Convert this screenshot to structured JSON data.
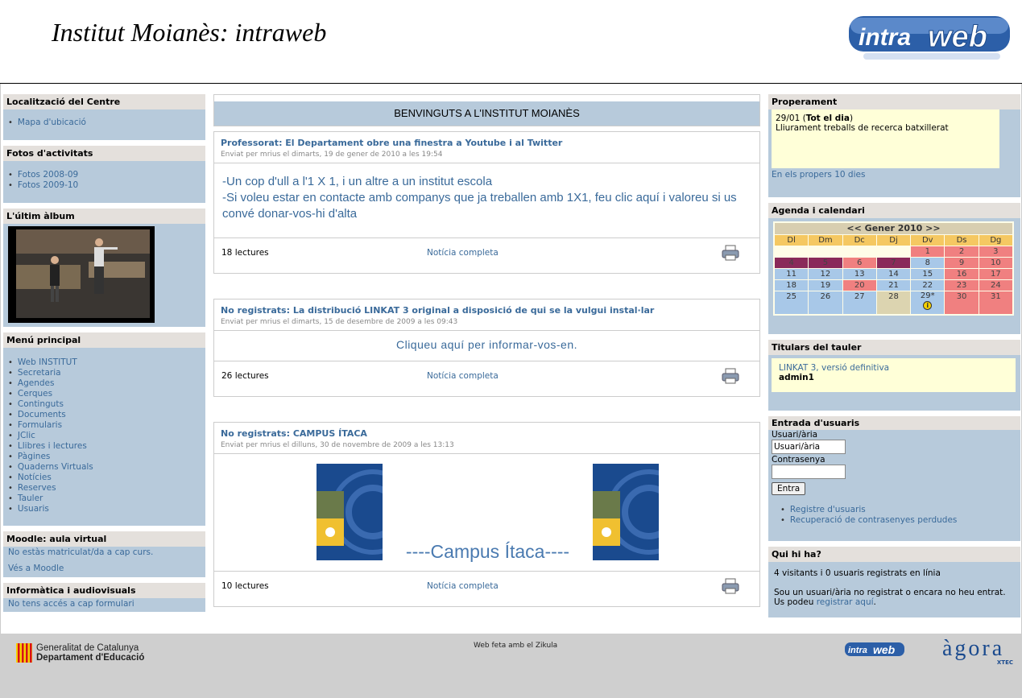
{
  "header": {
    "title": "Institut Moianès: intraweb",
    "logo": "intraweb"
  },
  "left": {
    "localitzacio": {
      "title": "Localització del Centre",
      "items": [
        "Mapa d'ubicació"
      ]
    },
    "fotos": {
      "title": "Fotos d'activitats",
      "items": [
        "Fotos 2008-09",
        "Fotos 2009-10"
      ]
    },
    "album": {
      "title": "L'últim àlbum"
    },
    "menu": {
      "title": "Menú principal",
      "items": [
        "Web INSTITUT",
        "Secretaria",
        "Agendes",
        "Cerques",
        "Continguts",
        "Documents",
        "Formularis",
        "JClic",
        "Llibres i lectures",
        "Pàgines",
        "Quaderns Virtuals",
        "Notícies",
        "Reserves",
        "Tauler",
        "Usuaris"
      ]
    },
    "moodle": {
      "title": "Moodle: aula virtual",
      "text": "No estàs matriculat/da a cap curs.",
      "link": "Vés a Moodle"
    },
    "informatica": {
      "title": "Informàtica i audiovisuals",
      "text": "No tens accés a cap formulari"
    }
  },
  "center": {
    "welcome": "BENVINGUTS A L'INSTITUT MOIANÈS",
    "articles": [
      {
        "category": "Professorat",
        "title": "El Departament obre una finestra a Youtube i al Twitter",
        "meta": "Enviat per mrius el dimarts, 19 de gener de 2010 a les 19:54",
        "body": [
          "-Un cop d'ull a l'1 X 1, i un altre a un institut escola",
          "-Si voleu estar en contacte amb companys que ja treballen amb 1X1, feu clic aquí i valoreu si us convé donar-vos-hi d'alta"
        ],
        "reads": "18 lectures",
        "more": "Notícia completa"
      },
      {
        "category": "No registrats",
        "title": "La distribució LINKAT 3 original a disposició de qui se la vulgui instal·lar",
        "meta": "Enviat per mrius el dimarts, 15 de desembre de 2009 a les 09:43",
        "body": [
          "Cliqueu aquí per informar-vos-en."
        ],
        "reads": "26 lectures",
        "more": "Notícia completa"
      },
      {
        "category": "No registrats",
        "title": "CAMPUS ÍTACA",
        "meta": "Enviat per mrius el dilluns, 30 de novembre de 2009 a les 13:13",
        "body": [
          "----Campus Ítaca----"
        ],
        "reads": "10 lectures",
        "more": "Notícia completa"
      }
    ]
  },
  "right": {
    "properament": {
      "title": "Properament",
      "date": "29/01 (",
      "allday": "Tot el dia",
      "close": ")",
      "event": "Lliurament treballs de recerca batxillerat",
      "link": "En els propers 10 dies"
    },
    "agenda": {
      "title": "Agenda i calendari",
      "month": "<< Gener 2010 >>",
      "daynames": [
        "Dl",
        "Dm",
        "Dc",
        "Dj",
        "Dv",
        "Ds",
        "Dg"
      ]
    },
    "titulars": {
      "title": "Titulars del tauler",
      "link": "LINKAT 3, versió definitiva",
      "author": "admin1"
    },
    "login": {
      "title": "Entrada d'usuaris",
      "user_label": "Usuari/ària",
      "user_value": "Usuari/ària",
      "pass_label": "Contrasenya",
      "button": "Entra",
      "links": [
        "Registre d'usuaris",
        "Recuperació de contrasenyes perdudes"
      ]
    },
    "quihiha": {
      "title": "Qui hi ha?",
      "count": "4 visitants i 0 usuaris registrats en línia",
      "text": "Sou un usuari/ària no registrat o encara no heu entrat. Us podeu",
      "link": "registrar aquí",
      "end": "."
    }
  },
  "footer": {
    "gen1": "Generalitat de Catalunya",
    "gen2": "Departament d'Educació",
    "zikula": "Web feta amb el Zikula",
    "agora": "àgora",
    "xtec": "XTEC"
  },
  "colors": {
    "block_bg": "#b7cadb",
    "title_bg": "#e4e0dc",
    "link": "#3a6a9a"
  }
}
